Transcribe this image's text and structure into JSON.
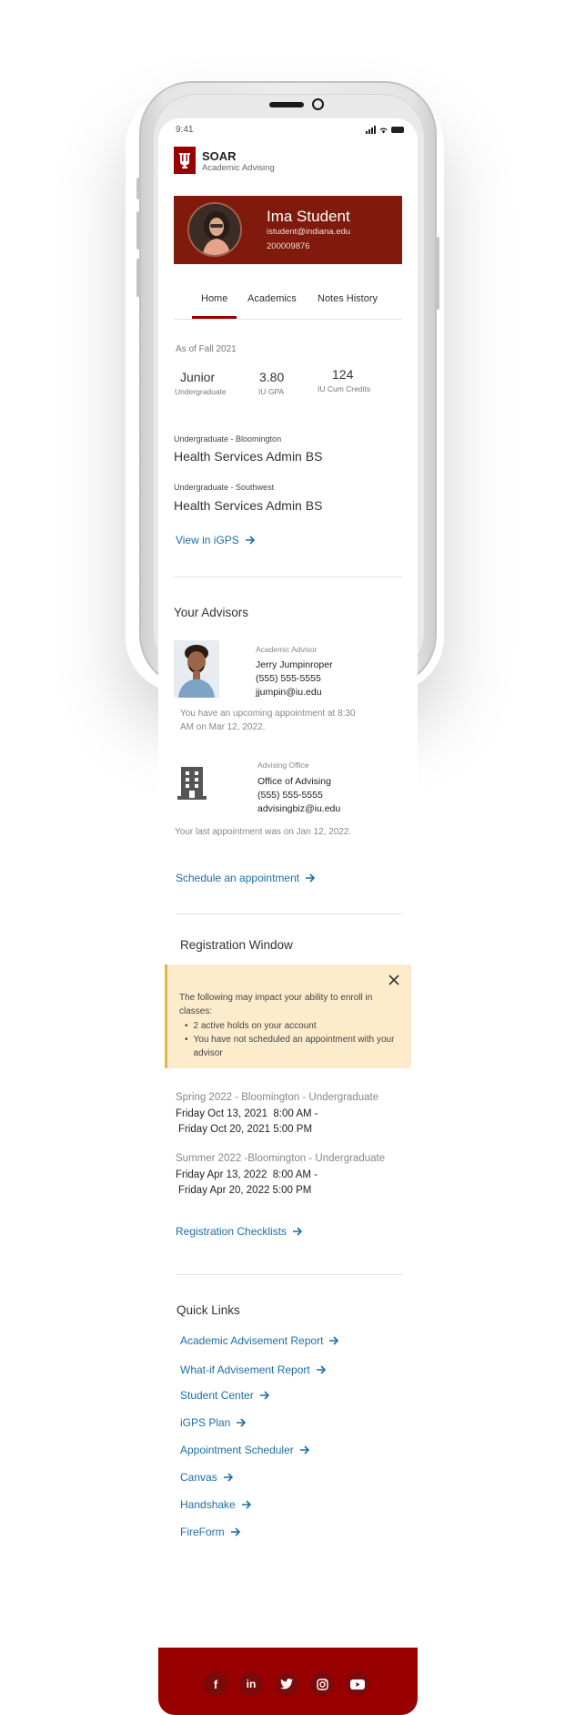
{
  "status_bar": {
    "time": "9:41"
  },
  "brand": {
    "title": "SOAR",
    "subtitle": "Academic Advising",
    "logo_icon": "iu-trident-logo",
    "color": "#990000"
  },
  "profile": {
    "name": "Ima Student",
    "email": "istudent@indiana.edu",
    "id": "200009876",
    "bg_color": "#7f1a0c"
  },
  "tabs": [
    {
      "label": "Home",
      "active": true
    },
    {
      "label": "Academics"
    },
    {
      "label": "Notes History"
    }
  ],
  "summary": {
    "as_of": "As of Fall 2021",
    "stats": [
      {
        "value": "Junior",
        "label": "Undergraduate"
      },
      {
        "value": "3.80",
        "label": "IU GPA"
      },
      {
        "value": "124",
        "label": "IU Cum Credits"
      }
    ]
  },
  "programs": [
    {
      "label": "Undergraduate - Bloomington",
      "name": "Health Services Admin BS"
    },
    {
      "label": "Undergraduate - Southwest",
      "name": "Health Services Admin BS"
    }
  ],
  "view_igps": "View in iGPS",
  "advisors": {
    "title": "Your Advisors",
    "academic": {
      "role": "Academic Advisor",
      "name": "Jerry Jumpinroper",
      "phone": "(555) 555-5555",
      "email": "jjumpin@iu.edu",
      "note": "You have an upcoming appointment at 8:30 AM on Mar 12, 2022."
    },
    "office": {
      "role": "Advising Office",
      "name": "Office of Advising",
      "phone": "(555) 555-5555",
      "email": "advisingbiz@iu.edu",
      "note": "Your last appointment was on Jan 12, 2022.",
      "icon": "building-icon"
    },
    "schedule_link": "Schedule an appointment"
  },
  "registration": {
    "title": "Registration Window",
    "alert": {
      "intro": "The following may impact your ability to enroll in classes:",
      "items": [
        "2 active holds on your account",
        "You have not scheduled an appointment with your advisor"
      ]
    },
    "windows": [
      {
        "term": "Spring 2022 - Bloomington - Undergraduate",
        "start": "Friday Oct 13, 2021  8:00 AM -",
        "end": "Friday Oct 20, 2021 5:00 PM"
      },
      {
        "term": "Summer 2022 -Bloomington - Undergraduate",
        "start": "Friday Apr 13, 2022  8:00 AM -",
        "end": "Friday Apr 20, 2022 5:00 PM"
      }
    ],
    "checklists_link": "Registration Checklists"
  },
  "quick_links": {
    "title": "Quick Links",
    "items": [
      "Academic Advisement Report",
      "What-if Advisement Report",
      "Student Center",
      "iGPS Plan",
      "Appointment Scheduler",
      "Canvas",
      "Handshake",
      "FireForm"
    ]
  },
  "footer": {
    "social": [
      {
        "icon": "facebook-icon",
        "glyph": "f"
      },
      {
        "icon": "linkedin-icon",
        "glyph": "in"
      },
      {
        "icon": "twitter-icon",
        "glyph": ""
      },
      {
        "icon": "instagram-icon",
        "glyph": ""
      },
      {
        "icon": "youtube-icon",
        "glyph": ""
      }
    ]
  },
  "link_color": "#1d6fa5"
}
